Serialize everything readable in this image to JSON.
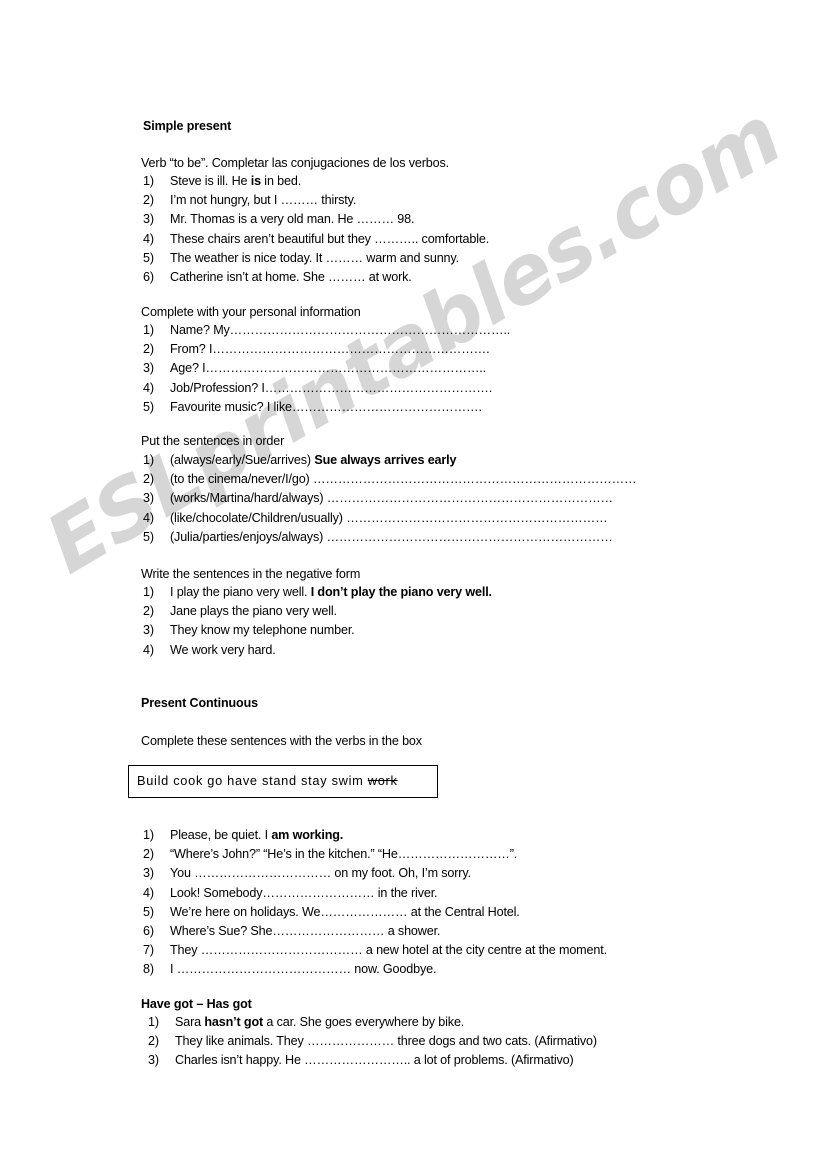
{
  "watermark": {
    "text": "ESLprintables.com",
    "color": "#d6d6d6"
  },
  "sections": {
    "simple_present": {
      "heading": "Simple present",
      "instruction": "Verb “to be”. Completar las conjugaciones de los verbos.",
      "items": [
        {
          "num": "1)",
          "pre": "Steve is ill. He ",
          "bold": "is",
          "post": " in bed."
        },
        {
          "num": "2)",
          "pre": "I’m not hungry, but I ……… thirsty.",
          "bold": "",
          "post": ""
        },
        {
          "num": "3)",
          "pre": "Mr. Thomas is a very old man. He ……… 98.",
          "bold": "",
          "post": ""
        },
        {
          "num": "4)",
          "pre": "These chairs aren’t beautiful but they ……….. comfortable.",
          "bold": "",
          "post": ""
        },
        {
          "num": "5)",
          "pre": "The weather is nice today. It ……… warm and sunny.",
          "bold": "",
          "post": ""
        },
        {
          "num": "6)",
          "pre": "Catherine isn’t at home. She ……… at work.",
          "bold": "",
          "post": ""
        }
      ]
    },
    "personal_info": {
      "instruction": "Complete with your personal information",
      "items": [
        {
          "num": "1)",
          "pre": "Name?  My…………………………………………………………..",
          "bold": "",
          "post": ""
        },
        {
          "num": "2)",
          "pre": "From?   I………………………………………………………….",
          "bold": "",
          "post": ""
        },
        {
          "num": "3)",
          "pre": "Age?  I…………………………………………………………..",
          "bold": "",
          "post": ""
        },
        {
          "num": "4)",
          "pre": "Job/Profession? I……………………………………………….",
          "bold": "",
          "post": ""
        },
        {
          "num": "5)",
          "pre": "Favourite music? I like……………………………………….",
          "bold": "",
          "post": ""
        }
      ]
    },
    "sentence_order": {
      "instruction": "Put the sentences in order",
      "items": [
        {
          "num": "1)",
          "pre": "(always/early/Sue/arrives)  ",
          "bold": "Sue always arrives early",
          "post": ""
        },
        {
          "num": "2)",
          "pre": "(to the cinema/never/I/go) ……………………………………………………………………",
          "bold": "",
          "post": ""
        },
        {
          "num": "3)",
          "pre": "(works/Martina/hard/always) ……………………………………………………………",
          "bold": "",
          "post": ""
        },
        {
          "num": "4)",
          "pre": "(like/chocolate/Children/usually) ………………………………………………………",
          "bold": "",
          "post": ""
        },
        {
          "num": "5)",
          "pre": "(Julia/parties/enjoys/always) ……………………………………………………………",
          "bold": "",
          "post": ""
        }
      ]
    },
    "negative_form": {
      "instruction": "Write the sentences in the negative form",
      "items": [
        {
          "num": "1)",
          "pre": "I play the piano very well.  ",
          "bold": "I don’t play the piano very well.",
          "post": ""
        },
        {
          "num": "2)",
          "pre": "Jane plays the piano very well.",
          "bold": "",
          "post": ""
        },
        {
          "num": "3)",
          "pre": "They know my telephone number.",
          "bold": "",
          "post": ""
        },
        {
          "num": "4)",
          "pre": "We work very hard.",
          "bold": "",
          "post": ""
        }
      ]
    },
    "present_continuous": {
      "heading": "Present Continuous",
      "instruction": "Complete these sentences with the verbs in the box",
      "verb_box": {
        "verbs": [
          "Build",
          "cook",
          "go",
          "have",
          "stand",
          "stay",
          "swim"
        ],
        "struck_verb": "work"
      },
      "items": [
        {
          "num": "1)",
          "pre": "Please, be quiet. I ",
          "bold": "am working.",
          "post": ""
        },
        {
          "num": "2)",
          "pre": "“Where’s John?” “He’s in the kitchen.” “He………………………”.",
          "bold": "",
          "post": ""
        },
        {
          "num": "3)",
          "pre": "You …………………………… on my foot.  Oh, I’m sorry.",
          "bold": "",
          "post": ""
        },
        {
          "num": "4)",
          "pre": "Look! Somebody……………………… in the river.",
          "bold": "",
          "post": ""
        },
        {
          "num": "5)",
          "pre": "We’re here on holidays. We………………… at the Central Hotel.",
          "bold": "",
          "post": ""
        },
        {
          "num": "6)",
          "pre": "Where’s Sue? She……………………… a shower.",
          "bold": "",
          "post": ""
        },
        {
          "num": "7)",
          "pre": "They ………………………………… a new hotel at the city centre at the moment.",
          "bold": "",
          "post": ""
        },
        {
          "num": "8)",
          "pre": "I …………………………………… now. Goodbye.",
          "bold": "",
          "post": ""
        }
      ]
    },
    "have_got": {
      "heading": "Have got – Has got",
      "items": [
        {
          "num": "1)",
          "pre": "Sara ",
          "bold": "hasn’t got",
          "post": " a car. She goes everywhere by bike."
        },
        {
          "num": "2)",
          "pre": "They like animals. They ………………… three dogs and two cats. (Afirmativo)",
          "bold": "",
          "post": ""
        },
        {
          "num": "3)",
          "pre": "Charles isn’t happy. He …………………….. a lot of problems. (Afirmativo)",
          "bold": "",
          "post": ""
        }
      ]
    }
  }
}
